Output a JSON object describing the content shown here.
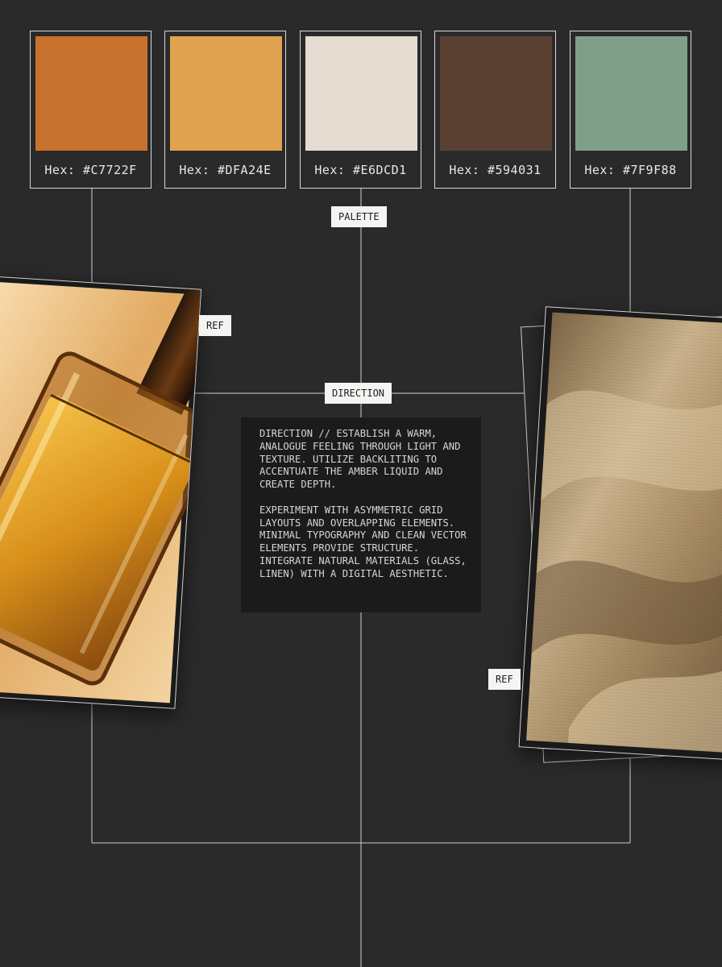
{
  "palette": {
    "label": "PALETTE",
    "swatches": [
      {
        "color": "#C7722F",
        "hex_label": "Hex: #C7722F"
      },
      {
        "color": "#DFA24E",
        "hex_label": "Hex: #DFA24E"
      },
      {
        "color": "#E6DCD1",
        "hex_label": "Hex: #E6DCD1"
      },
      {
        "color": "#594031",
        "hex_label": "Hex: #594031"
      },
      {
        "color": "#7F9F88",
        "hex_label": "Hex: #7F9F88"
      }
    ]
  },
  "direction": {
    "label": "DIRECTION",
    "paragraph1": "DIRECTION // ESTABLISH A WARM, ANALOGUE FEELING THROUGH LIGHT AND TEXTURE. UTILIZE BACKLITING TO ACCENTUATE THE AMBER LIQUID AND CREATE DEPTH.",
    "paragraph2": "EXPERIMENT WITH ASYMMETRIC GRID LAYOUTS AND OVERLAPPING ELEMENTS. MINIMAL TYPOGRAPHY AND CLEAN VECTOR ELEMENTS PROVIDE STRUCTURE. INTEGRATE NATURAL MATERIALS (GLASS, LINEN) WITH A DIGITAL AESTHETIC."
  },
  "references": [
    {
      "label": "REF",
      "subject": "amber perfume bottle"
    },
    {
      "label": "REF",
      "subject": "linen fabric"
    }
  ],
  "colors": {
    "background": "#2a2a2a",
    "line": "#d0d0d0",
    "tag_bg": "#f4f4f2",
    "text_box_bg": "#1b1b1b"
  }
}
